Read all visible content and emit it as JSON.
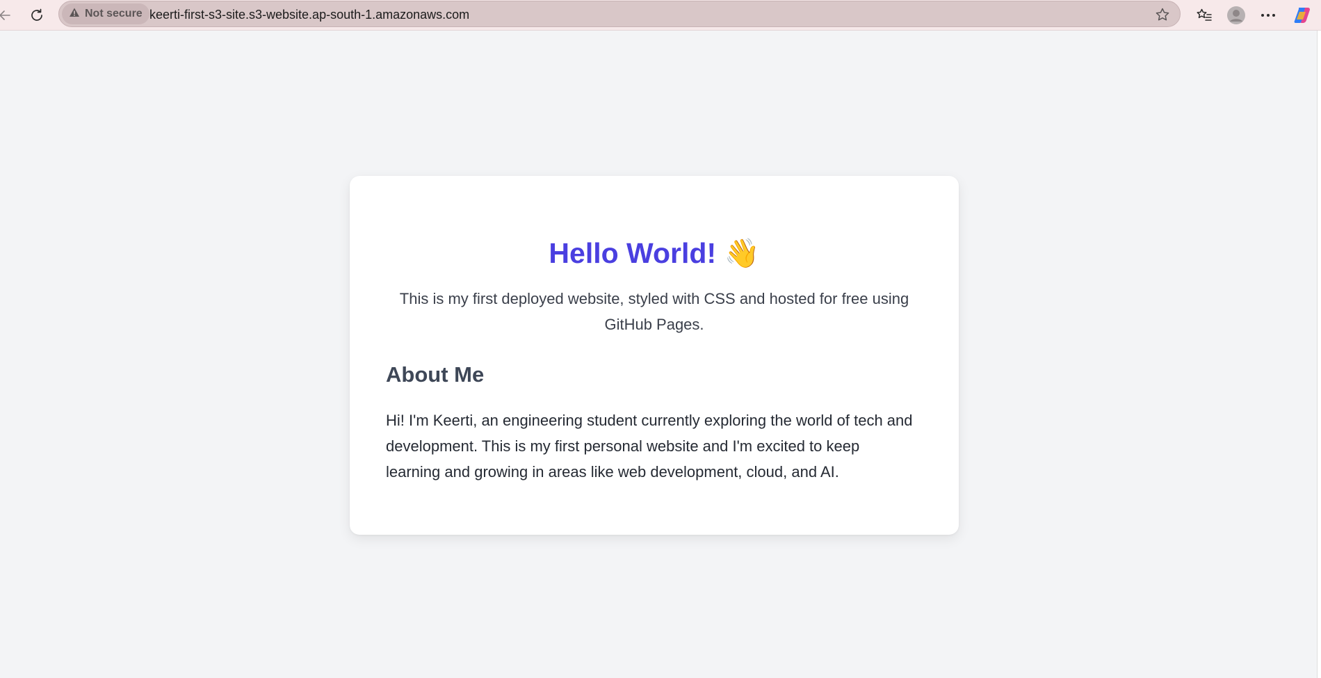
{
  "browser": {
    "security_label": "Not secure",
    "url": "keerti-first-s3-site.s3-website.ap-south-1.amazonaws.com",
    "icons": [
      "back-arrow-icon",
      "refresh-icon",
      "warning-icon",
      "star-icon",
      "favorites-icon",
      "profile-icon",
      "more-icon",
      "copilot-icon"
    ]
  },
  "page": {
    "title": "Hello World!",
    "title_emoji": "👋",
    "intro": "This is my first deployed website, styled with CSS and hosted for free using GitHub Pages.",
    "about_heading": "About Me",
    "about_text": "Hi! I'm Keerti, an engineering student currently exploring the world of tech and development. This is my first personal website and I'm excited to keep learning and growing in areas like web development, cloud, and AI.",
    "colors": {
      "title": "#4a3fe0",
      "background": "#f3f4f6",
      "card": "#ffffff"
    }
  }
}
